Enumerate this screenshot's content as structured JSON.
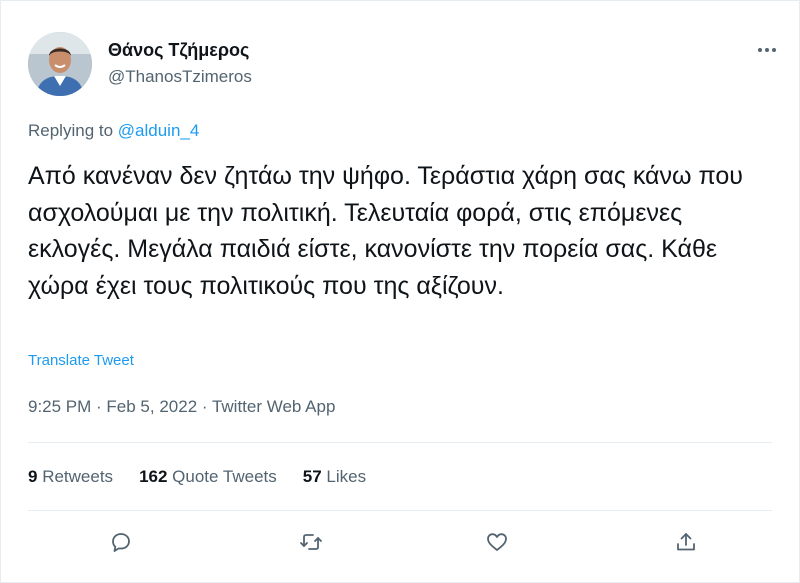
{
  "author": {
    "name": "Θάνος Τζήμερος",
    "handle": "@ThanosTzimeros"
  },
  "reply": {
    "prefix": "Replying to ",
    "mention": "@alduin_4"
  },
  "tweet": {
    "text": "Από κανέναν δεν ζητάω την ψήφο. Τεράστια χάρη σας κάνω που ασχολούμαι με την πολιτική. Τελευταία φορά, στις επόμενες εκλογές. Μεγάλα παιδιά είστε, κανονίστε την πορεία σας. Κάθε χώρα έχει τους πολιτικούς που της αξίζουν.",
    "translate_label": "Translate Tweet",
    "meta": "9:25 PM · Feb 5, 2022 · Twitter Web App"
  },
  "stats": {
    "retweets_count": "9",
    "retweets_label": " Retweets",
    "quotes_count": "162",
    "quotes_label": " Quote Tweets",
    "likes_count": "57",
    "likes_label": " Likes"
  },
  "icons": {
    "reply": "reply-icon",
    "retweet": "retweet-icon",
    "like": "like-icon",
    "share": "share-icon",
    "more": "more-icon"
  },
  "colors": {
    "accent": "#1d9bf0",
    "secondary_text": "#536471",
    "primary_text": "#0f1419",
    "divider": "#e6ecf0"
  }
}
